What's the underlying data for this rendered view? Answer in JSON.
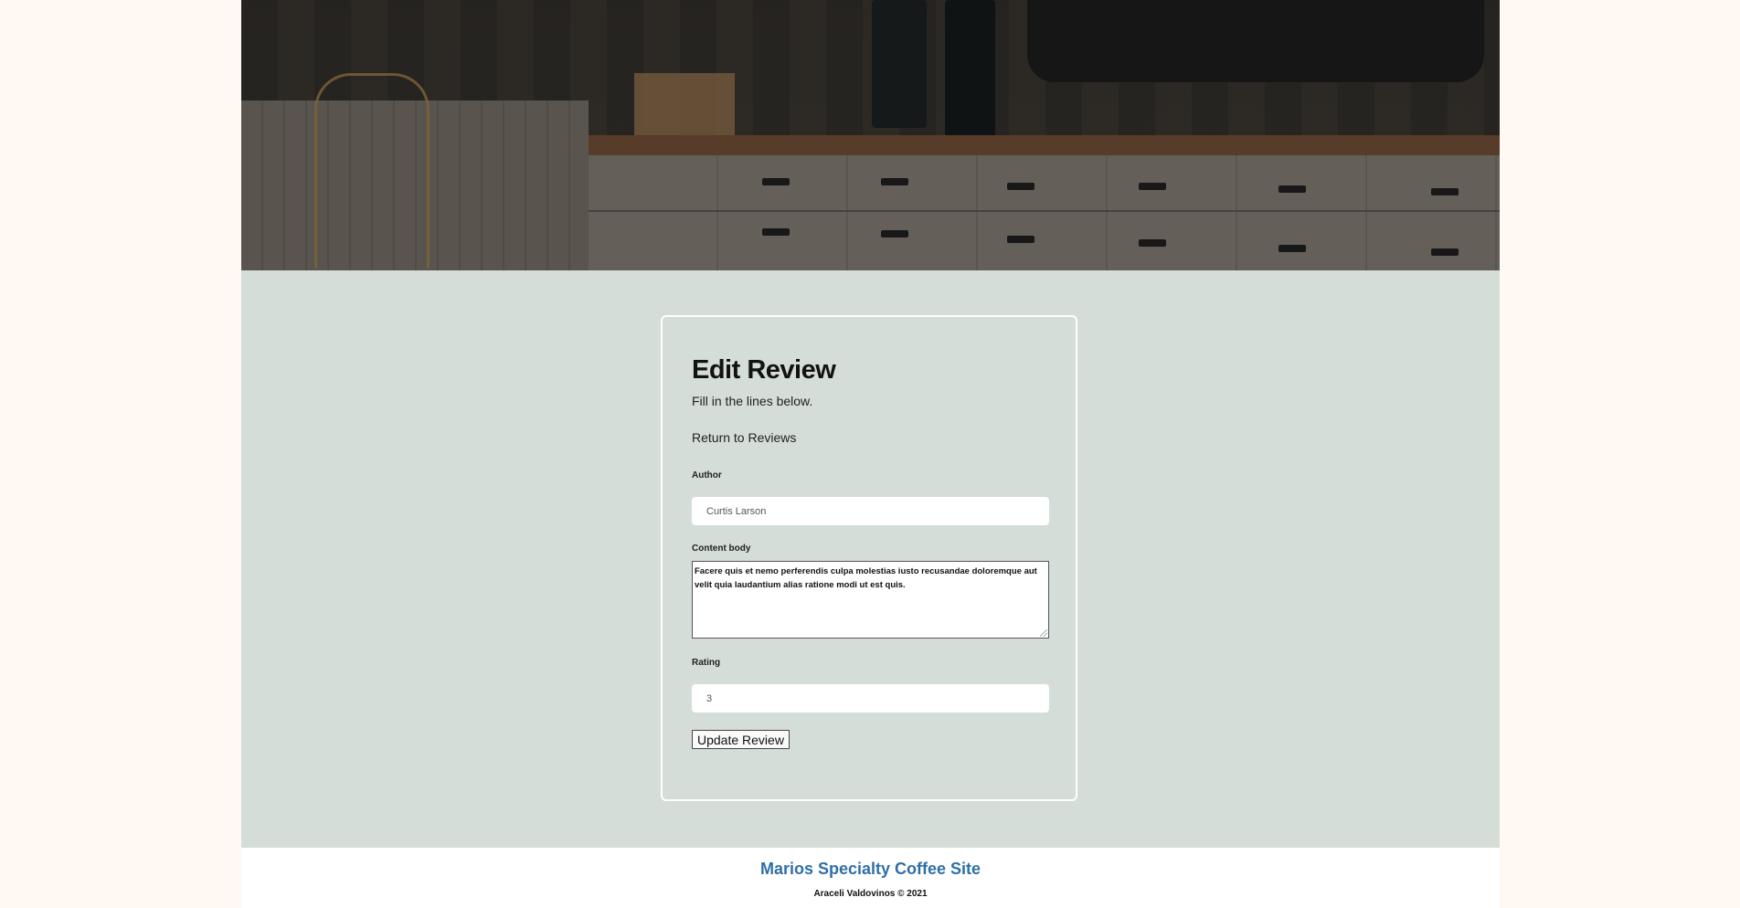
{
  "hero": {
    "alt": "coffee-shop-counter-photo"
  },
  "form": {
    "title": "Edit Review",
    "subtitle": "Fill in the lines below.",
    "back_link": "Return to Reviews",
    "author": {
      "label": "Author",
      "value": "Curtis Larson"
    },
    "content": {
      "label": "Content body",
      "value": "Facere quis et nemo perferendis culpa molestias iusto recusandae doloremque aut velit quia laudantium alias ratione modi ut est quis."
    },
    "rating": {
      "label": "Rating",
      "value": "3"
    },
    "submit_label": "Update Review"
  },
  "footer": {
    "brand": "Marios Specialty Coffee Site",
    "copyright": "Araceli Valdovinos © 2021"
  },
  "colors": {
    "page_bg": "#fff8f3",
    "main_bg": "#d5ddd8",
    "brand": "#2f6fa7"
  }
}
